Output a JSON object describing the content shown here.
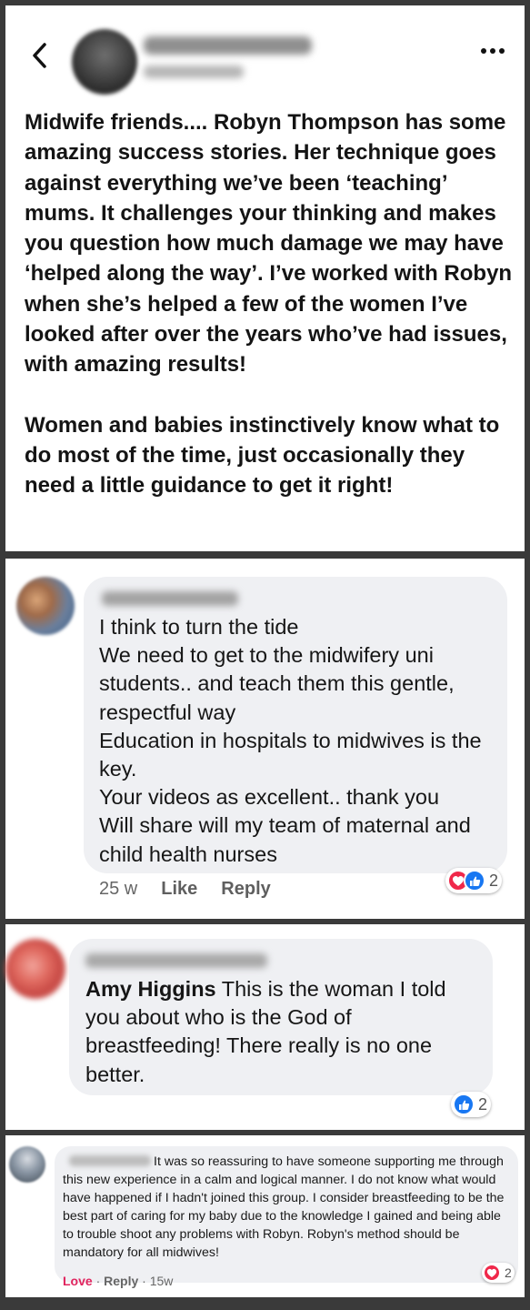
{
  "post": {
    "body": {
      "p1_before": "Midwife friends.... ",
      "p1_mention": "Robyn Thompson",
      "p1_after": " has some amazing success stories. Her technique goes against everything we’ve been ‘teaching’ mums. It challenges your thinking and makes you question how much damage we may have ‘helped along the way’. I’ve worked with Robyn when she’s helped a few of the women I’ve looked after over the years who’ve had issues, with amazing results!",
      "p2": "Women and babies instinctively know what to do most of the time, just occasionally they need a little guidance to get it right!"
    },
    "icons": {
      "back": "chevron-left-icon",
      "more": "more-dots-icon"
    }
  },
  "comments": [
    {
      "lines": [
        "I think to turn the tide",
        "We need to get to the midwifery uni students.. and teach them this gentle, respectful way",
        "Education in hospitals to midwives is the key.",
        "Your videos as excellent.. thank you",
        "Will share will my team of maternal and child health nurses"
      ],
      "time": "25 w",
      "like_label": "Like",
      "reply_label": "Reply",
      "reactions": {
        "types": [
          "love",
          "like"
        ],
        "count": "2"
      }
    },
    {
      "mention": "Amy Higgins",
      "text": " This is the woman I told you about who is the God of breastfeeding! There really is no one better.",
      "reactions": {
        "types": [
          "like"
        ],
        "count": "2"
      }
    },
    {
      "text": "It was so reassuring to have someone supporting me through this new experience in a calm and logical manner. I do not know what would have happened if I hadn't joined this group. I consider breastfeeding to be the best part of caring for my baby due to the knowledge I gained and being able to trouble shoot any problems with Robyn. Robyn's method should be mandatory for all midwives!",
      "love_label": "Love",
      "sep": " · ",
      "reply_label": "Reply",
      "time": "15w",
      "reactions": {
        "types": [
          "love"
        ],
        "count": "2"
      }
    }
  ],
  "colors": {
    "like_blue": "#1877f2",
    "love_red": "#f0284a",
    "bubble_gray": "#eff0f3"
  }
}
